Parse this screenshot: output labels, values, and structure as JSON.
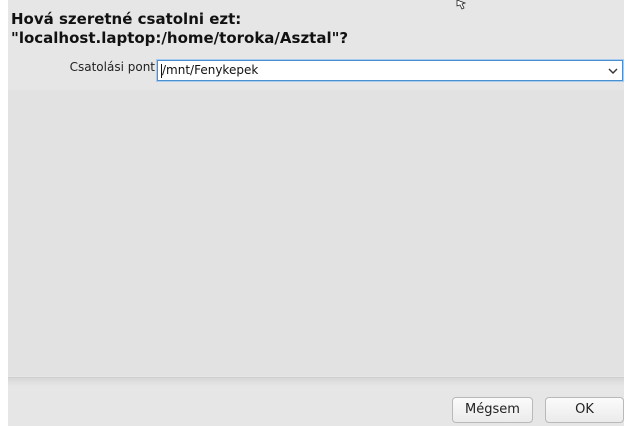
{
  "dialog": {
    "question": "Hová szeretné csatolni ezt: \"localhost.laptop:/home/toroka/Asztal\"?",
    "mount_point_label": "Csatolási pont",
    "mount_point_value": "/mnt/Fenykepek",
    "dropdown_icon": "chevron-down-icon",
    "buttons": {
      "cancel_label": "Mégsem",
      "ok_label": "OK"
    }
  },
  "colors": {
    "dialog_background": "#e6e6e6",
    "focus_border": "#4a8fd1"
  }
}
